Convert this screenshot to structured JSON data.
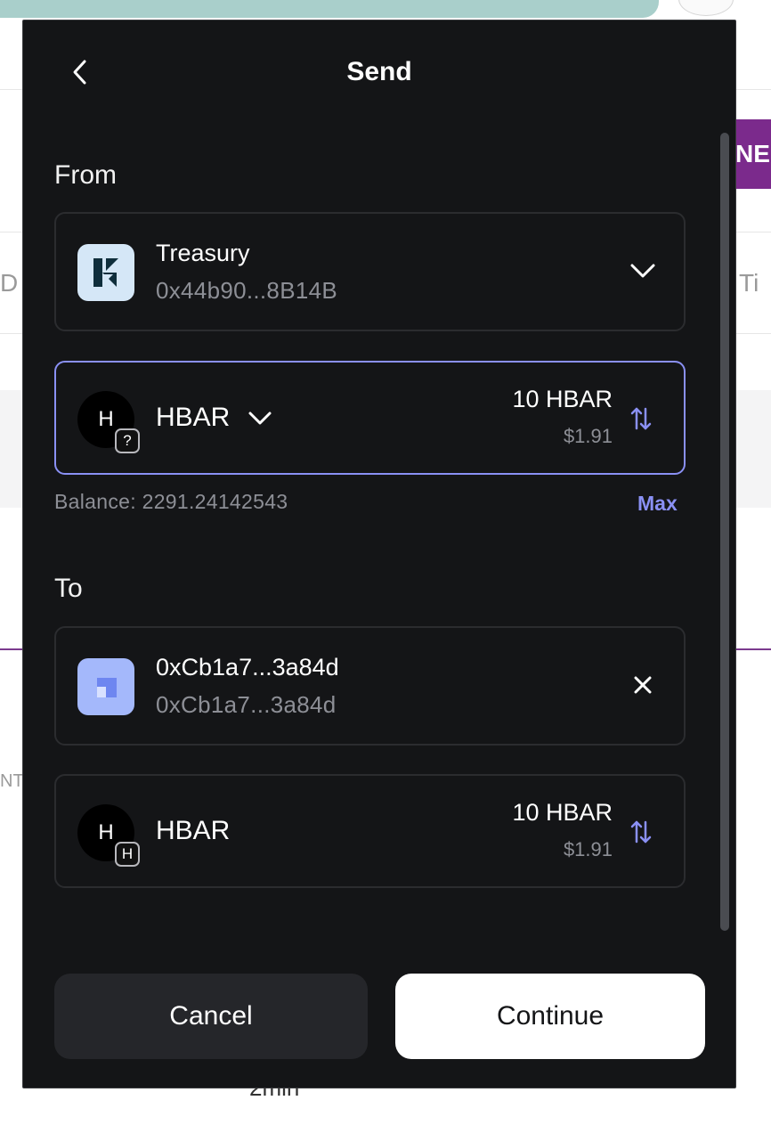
{
  "background": {
    "partial_button_text": "NE",
    "partial_text_left": "D",
    "partial_text_right": "Ti",
    "partial_text_nt": "NT",
    "partial_text_bottom": "2min"
  },
  "modal": {
    "title": "Send",
    "from_label": "From",
    "to_label": "To",
    "from_account": {
      "name": "Treasury",
      "address": "0x44b90...8B14B"
    },
    "from_token": {
      "avatar_letter": "H",
      "badge": "?",
      "symbol": "HBAR",
      "amount": "10 HBAR",
      "fiat": "$1.91"
    },
    "balance_text": "Balance: 2291.24142543",
    "max_label": "Max",
    "to_account": {
      "name": "0xCb1a7...3a84d",
      "address": "0xCb1a7...3a84d"
    },
    "to_token": {
      "avatar_letter": "H",
      "badge": "H",
      "symbol": "HBAR",
      "amount": "10 HBAR",
      "fiat": "$1.91"
    },
    "cancel_label": "Cancel",
    "continue_label": "Continue"
  },
  "colors": {
    "modal_bg": "#141517",
    "accent": "#8a90f4",
    "muted_text": "#8d8f96",
    "card_border": "#2b2c2f",
    "background_purple": "#7b2a8c"
  },
  "icons": [
    "chevron-left-icon",
    "chevron-down-icon",
    "close-icon",
    "swap-arrows-icon",
    "treasury-logo-icon",
    "recipient-logo-icon"
  ]
}
